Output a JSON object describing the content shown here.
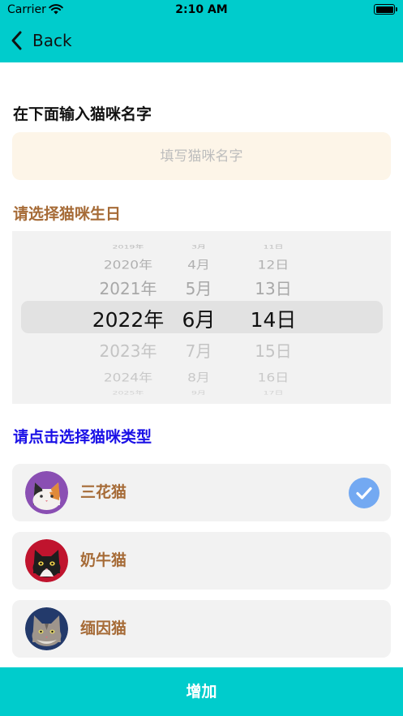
{
  "status_bar": {
    "carrier": "Carrier",
    "time": "2:10 AM"
  },
  "nav": {
    "back_label": "Back"
  },
  "form": {
    "name_label": "在下面输入猫咪名字",
    "name_placeholder": "填写猫咪名字",
    "name_value": "",
    "birthday_label": "请选择猫咪生日",
    "type_label": "请点击选择猫咪类型"
  },
  "date_picker": {
    "rows": [
      {
        "year": "2019年",
        "month": "3月",
        "day": "11日"
      },
      {
        "year": "2020年",
        "month": "4月",
        "day": "12日"
      },
      {
        "year": "2021年",
        "month": "5月",
        "day": "13日"
      },
      {
        "year": "2022年",
        "month": "6月",
        "day": "14日"
      },
      {
        "year": "2023年",
        "month": "7月",
        "day": "15日"
      },
      {
        "year": "2024年",
        "month": "8月",
        "day": "16日"
      },
      {
        "year": "2025年",
        "month": "9月",
        "day": "17日"
      }
    ],
    "selected": {
      "year": "2022年",
      "month": "6月",
      "day": "14日"
    }
  },
  "cat_types": [
    {
      "name": "三花猫",
      "avatar_color": "#8A4FB3",
      "selected": true
    },
    {
      "name": "奶牛猫",
      "avatar_color": "#C0142E",
      "selected": false
    },
    {
      "name": "缅因猫",
      "avatar_color": "#233A6B",
      "selected": false
    }
  ],
  "add_button": {
    "label": "增加"
  },
  "colors": {
    "accent": "#00CCCC",
    "brown_text": "#A66B37",
    "blue_label": "#1A10E6",
    "input_bg": "#FDF5E8",
    "check_blue": "#73A9F2"
  }
}
